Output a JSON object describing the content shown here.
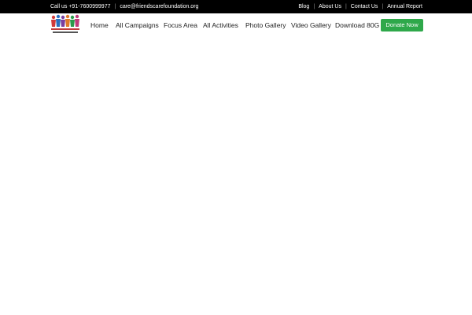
{
  "topbar": {
    "phone": "Call us +91-7600999977",
    "email": "care@friendscarefoundation.org",
    "links": [
      "Blog",
      "About Us",
      "Contact Us",
      "Annual Report"
    ]
  },
  "nav": {
    "items": [
      "Home",
      "All Campaigns",
      "Focus Area",
      "All Activities",
      "Photo Gallery",
      "Video Gallery",
      "Download 80G"
    ],
    "donate_label": "Donate Now"
  },
  "colors": {
    "topbar_bg": "#000000",
    "donate_bg": "#2ea84a",
    "logo_figures": [
      "#d13a3a",
      "#2a6fbf",
      "#7a3fa0",
      "#e07a2a",
      "#2a9a4a",
      "#c03a7a"
    ]
  },
  "icons": {
    "logo": "friends-care-foundation-logo"
  }
}
